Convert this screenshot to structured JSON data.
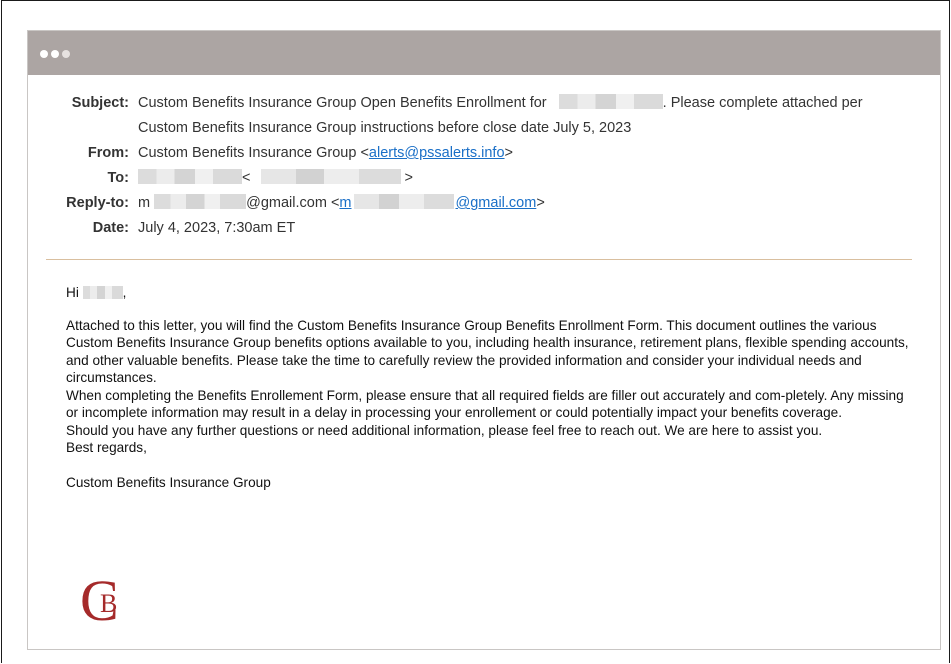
{
  "email": {
    "headers": {
      "subject_label": "Subject:",
      "subject_line1_a": "Custom Benefits Insurance Group Open Benefits Enrollment for",
      "subject_line1_b": ". Please complete attached per",
      "subject_line2": "Custom Benefits Insurance Group instructions before close date July 5, 2023",
      "from_label": "From:",
      "from_name": "Custom Benefits Insurance Group <",
      "from_email": "alerts@pssalerts.info",
      "from_close": ">",
      "to_label": "To:",
      "to_lt": "<",
      "to_gt": ">",
      "replyto_label": "Reply-to:",
      "replyto_prefix": "m",
      "replyto_suffix": "@gmail.com <",
      "replyto_link_prefix": "m",
      "replyto_link_suffix": "@gmail.com",
      "replyto_close": ">",
      "date_label": "Date:",
      "date_value": "July 4, 2023, 7:30am ET"
    },
    "body": {
      "greeting_prefix": "Hi",
      "greeting_suffix": ",",
      "paragraph1": "Attached to this letter, you will find the Custom Benefits Insurance Group Benefits Enrollment Form. This document outlines the various Custom Benefits Insurance Group benefits options available to you, including health insurance, retirement plans, flexible spending accounts, and other valuable benefits. Please take the time to carefully review the provided information and consider your individual needs and circumstances.",
      "paragraph2": "When completing the Benefits Enrollement Form, please ensure that all required fields are filler out accurately and com-pletely. Any missing or incomplete information may result in a delay in processing your enrollement or could potentially impact your benefits coverage.",
      "paragraph3": "Should you have any further questions or need additional information, please feel free to reach out. We are here to assist you.",
      "closing": "Best regards,",
      "signature": "Custom Benefits Insurance Group"
    },
    "logo_text": "CB",
    "colors": {
      "titlebar": "#aca5a3",
      "link": "#1a6fc7",
      "divider": "#d9bf9f",
      "logo": "#a52a2a"
    }
  }
}
